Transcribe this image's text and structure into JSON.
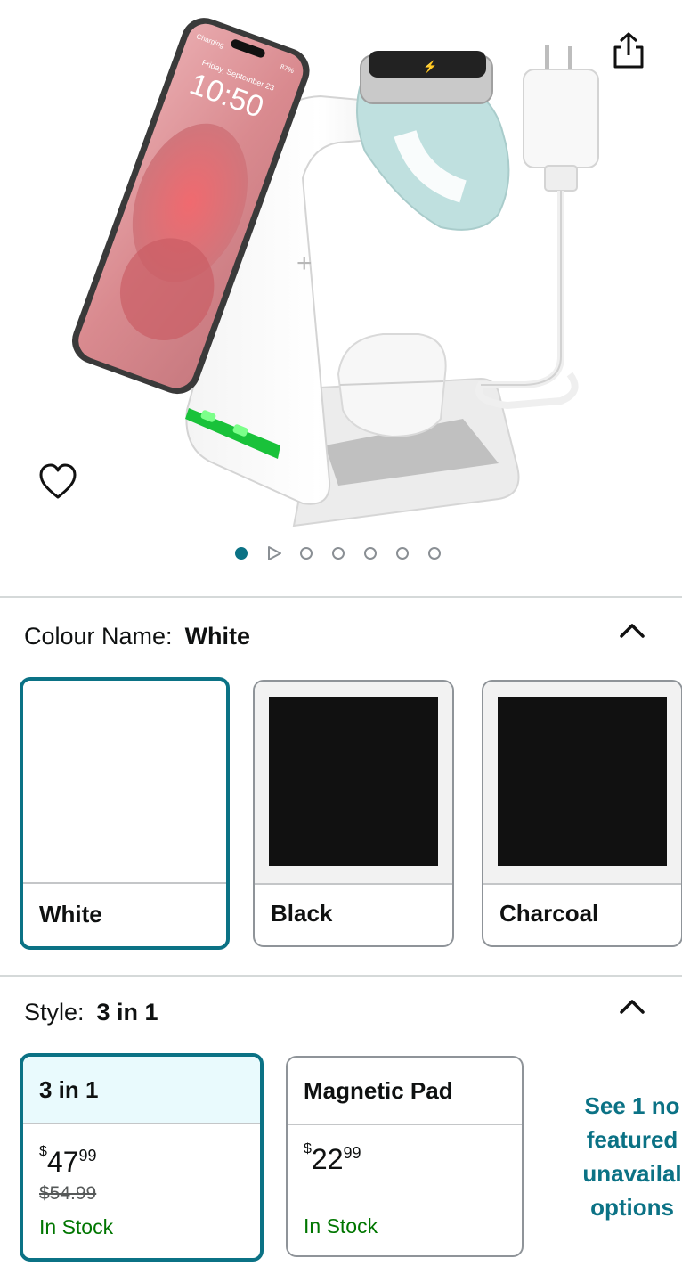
{
  "product_image": {
    "pagination_count": 7,
    "active_index": 0
  },
  "phone_screen": {
    "status_left": "Charging",
    "status_right": "87%",
    "date": "Friday, September 23",
    "time": "10:50"
  },
  "colour": {
    "label": "Colour Name:",
    "selected": "White",
    "options": [
      {
        "name": "White",
        "swatch": "#ffffff"
      },
      {
        "name": "Black",
        "swatch": "#111111"
      },
      {
        "name": "Charcoal",
        "swatch": "#111111"
      }
    ]
  },
  "style": {
    "label": "Style:",
    "selected": "3 in 1",
    "options": [
      {
        "name": "3 in 1",
        "price_symbol": "$",
        "price_whole": "47",
        "price_cents": "99",
        "list_price": "$54.99",
        "stock": "In Stock"
      },
      {
        "name": "Magnetic Pad",
        "price_symbol": "$",
        "price_whole": "22",
        "price_cents": "99",
        "list_price": "",
        "stock": "In Stock"
      }
    ],
    "see_more": [
      "See 1 no",
      "featured",
      "unavailal",
      "options"
    ]
  },
  "colors": {
    "accent": "#0b7285",
    "in_stock": "#007600",
    "selected_bg": "#e9fafd"
  }
}
